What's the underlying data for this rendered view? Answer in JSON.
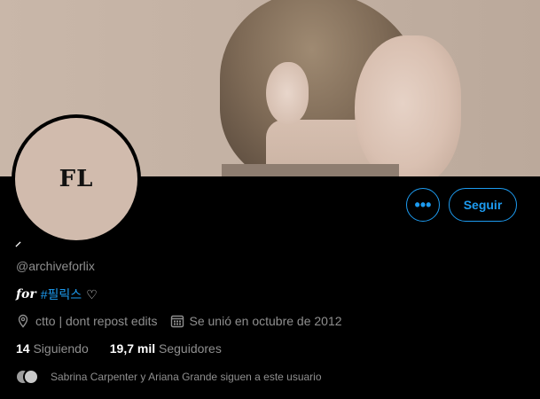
{
  "profile": {
    "avatar_initials": "FL",
    "display_name": "⸝",
    "handle": "@archiveforlix",
    "bio_prefix": "for",
    "bio_hashtag": "#필릭스",
    "bio_heart": "♡",
    "location": "ctto | dont repost edits",
    "joined": "Se unió en octubre de 2012",
    "following_count": "14",
    "following_label": "Siguiendo",
    "followers_count": "19,7 mil",
    "followers_label": "Seguidores",
    "followed_by": "Sabrina Carpenter y Ariana Grande siguen a este usuario"
  },
  "actions": {
    "more_label": "•••",
    "follow_label": "Seguir"
  },
  "icons": {
    "location": "location-pin-icon",
    "calendar": "calendar-icon"
  },
  "colors": {
    "accent": "#1d9bf0",
    "background": "#000000",
    "muted_text": "#8f8f8f"
  }
}
